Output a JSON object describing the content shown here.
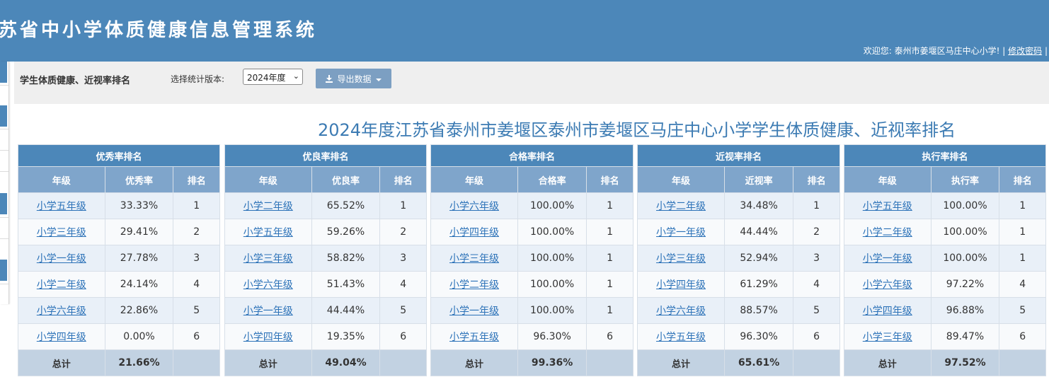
{
  "header": {
    "system_title": "苏省中小学体质健康信息管理系统",
    "welcome": "欢迎您: 泰州市姜堰区马庄中心小学!",
    "separator": "|",
    "change_password": "修改密码"
  },
  "toolbar": {
    "page_title": "学生体质健康、近视率排名",
    "version_label": "选择统计版本:",
    "version_selected": "2024年度",
    "export_label": "导出数据"
  },
  "report_title": "2024年度江苏省泰州市姜堰区泰州市姜堰区马庄中心小学学生体质健康、近视率排名",
  "tables": [
    {
      "caption": "优秀率排名",
      "headers": [
        "年级",
        "优秀率",
        "排名"
      ],
      "rows": [
        {
          "grade": "小学五年级",
          "rate": "33.33%",
          "rank": "1"
        },
        {
          "grade": "小学三年级",
          "rate": "29.41%",
          "rank": "2"
        },
        {
          "grade": "小学一年级",
          "rate": "27.78%",
          "rank": "3"
        },
        {
          "grade": "小学二年级",
          "rate": "24.14%",
          "rank": "4"
        },
        {
          "grade": "小学六年级",
          "rate": "22.86%",
          "rank": "5"
        },
        {
          "grade": "小学四年级",
          "rate": "0.00%",
          "rank": "6"
        }
      ],
      "total_label": "总计",
      "total_value": "21.66%"
    },
    {
      "caption": "优良率排名",
      "headers": [
        "年级",
        "优良率",
        "排名"
      ],
      "rows": [
        {
          "grade": "小学二年级",
          "rate": "65.52%",
          "rank": "1"
        },
        {
          "grade": "小学五年级",
          "rate": "59.26%",
          "rank": "2"
        },
        {
          "grade": "小学三年级",
          "rate": "58.82%",
          "rank": "3"
        },
        {
          "grade": "小学六年级",
          "rate": "51.43%",
          "rank": "4"
        },
        {
          "grade": "小学一年级",
          "rate": "44.44%",
          "rank": "5"
        },
        {
          "grade": "小学四年级",
          "rate": "19.35%",
          "rank": "6"
        }
      ],
      "total_label": "总计",
      "total_value": "49.04%"
    },
    {
      "caption": "合格率排名",
      "headers": [
        "年级",
        "合格率",
        "排名"
      ],
      "rows": [
        {
          "grade": "小学六年级",
          "rate": "100.00%",
          "rank": "1"
        },
        {
          "grade": "小学四年级",
          "rate": "100.00%",
          "rank": "1"
        },
        {
          "grade": "小学三年级",
          "rate": "100.00%",
          "rank": "1"
        },
        {
          "grade": "小学二年级",
          "rate": "100.00%",
          "rank": "1"
        },
        {
          "grade": "小学一年级",
          "rate": "100.00%",
          "rank": "1"
        },
        {
          "grade": "小学五年级",
          "rate": "96.30%",
          "rank": "6"
        }
      ],
      "total_label": "总计",
      "total_value": "99.36%"
    },
    {
      "caption": "近视率排名",
      "headers": [
        "年级",
        "近视率",
        "排名"
      ],
      "rows": [
        {
          "grade": "小学二年级",
          "rate": "34.48%",
          "rank": "1"
        },
        {
          "grade": "小学一年级",
          "rate": "44.44%",
          "rank": "2"
        },
        {
          "grade": "小学三年级",
          "rate": "52.94%",
          "rank": "3"
        },
        {
          "grade": "小学四年级",
          "rate": "61.29%",
          "rank": "4"
        },
        {
          "grade": "小学六年级",
          "rate": "88.57%",
          "rank": "5"
        },
        {
          "grade": "小学五年级",
          "rate": "96.30%",
          "rank": "6"
        }
      ],
      "total_label": "总计",
      "total_value": "65.61%"
    },
    {
      "caption": "执行率排名",
      "headers": [
        "年级",
        "执行率",
        "排名"
      ],
      "rows": [
        {
          "grade": "小学五年级",
          "rate": "100.00%",
          "rank": "1"
        },
        {
          "grade": "小学二年级",
          "rate": "100.00%",
          "rank": "1"
        },
        {
          "grade": "小学一年级",
          "rate": "100.00%",
          "rank": "1"
        },
        {
          "grade": "小学六年级",
          "rate": "97.22%",
          "rank": "4"
        },
        {
          "grade": "小学四年级",
          "rate": "96.88%",
          "rank": "5"
        },
        {
          "grade": "小学三年级",
          "rate": "89.47%",
          "rank": "6"
        }
      ],
      "total_label": "总计",
      "total_value": "97.52%"
    }
  ],
  "colors": {
    "header_bg": "#4c87b9",
    "caption_bg": "#4c87b9",
    "column_header_bg": "#7fa5cb",
    "row_alt_bg": "#e9f0f8",
    "total_row_bg": "#c2d2e2",
    "link_color": "#2c72b8",
    "report_title_color": "#3c7bb3"
  }
}
